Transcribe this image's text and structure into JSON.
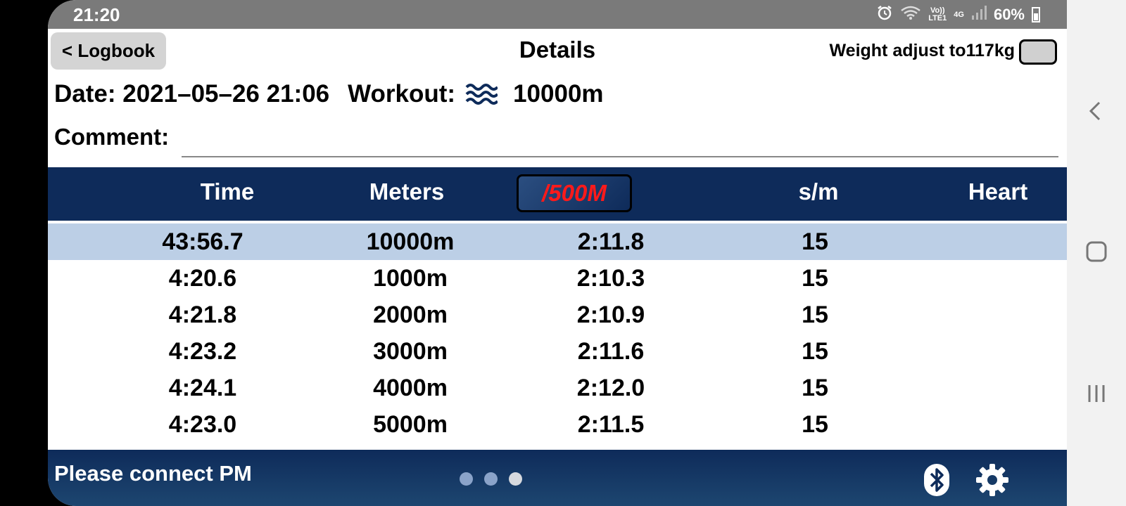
{
  "status_bar": {
    "time": "21:20",
    "signal_label_top": "Vo))",
    "signal_label_bottom": "LTE1",
    "network": "4G",
    "battery": "60%"
  },
  "header": {
    "back_label": "< Logbook",
    "title": "Details",
    "weight_label": "Weight adjust to117kg"
  },
  "info": {
    "date_label": "Date: 2021–05–26 21:06",
    "workout_label": "Workout:",
    "workout_icon": "waves-icon",
    "workout_value": "10000m",
    "comment_label": "Comment:",
    "comment_value": ""
  },
  "table": {
    "columns": {
      "time": "Time",
      "meters": "Meters",
      "pace": "/500M",
      "spm": "s/m",
      "heart": "Heart"
    },
    "rows": [
      {
        "time": "43:56.7",
        "meters": "10000m",
        "pace": "2:11.8",
        "spm": "15",
        "heart": ""
      },
      {
        "time": "4:20.6",
        "meters": "1000m",
        "pace": "2:10.3",
        "spm": "15",
        "heart": ""
      },
      {
        "time": "4:21.8",
        "meters": "2000m",
        "pace": "2:10.9",
        "spm": "15",
        "heart": ""
      },
      {
        "time": "4:23.2",
        "meters": "3000m",
        "pace": "2:11.6",
        "spm": "15",
        "heart": ""
      },
      {
        "time": "4:24.1",
        "meters": "4000m",
        "pace": "2:12.0",
        "spm": "15",
        "heart": ""
      },
      {
        "time": "4:23.0",
        "meters": "5000m",
        "pace": "2:11.5",
        "spm": "15",
        "heart": ""
      }
    ]
  },
  "footer": {
    "status_message": "Please connect PM",
    "page_dots": 3,
    "active_dot": 3
  },
  "colors": {
    "header_bg": "#0e2b5a",
    "highlight_row": "#bccfe6",
    "pace_text": "#ff1a1a"
  }
}
